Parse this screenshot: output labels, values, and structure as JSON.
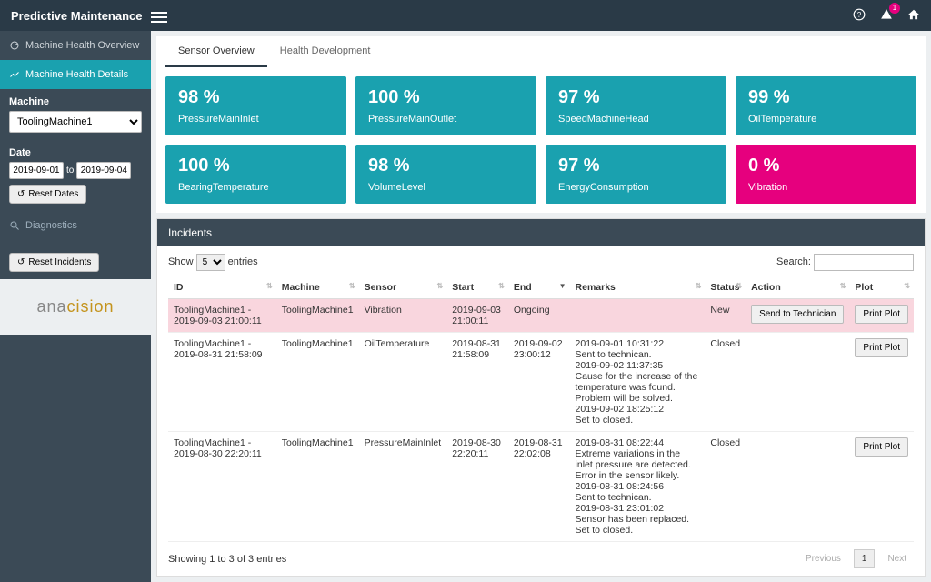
{
  "topbar": {
    "title": "Predictive Maintenance",
    "alert_count": "1"
  },
  "nav": {
    "overview": "Machine Health Overview",
    "details": "Machine Health Details",
    "diagnostics": "Diagnostics"
  },
  "side": {
    "machine_label": "Machine",
    "machine_value": "ToolingMachine1",
    "date_label": "Date",
    "date_from": "2019-09-01",
    "date_to_label": "to",
    "date_to": "2019-09-04",
    "reset_dates": "Reset Dates",
    "reset_incidents": "Reset Incidents"
  },
  "logo": {
    "p1": "ana",
    "p2": "cision"
  },
  "tabs": {
    "sensor": "Sensor Overview",
    "health": "Health Development"
  },
  "cards": [
    {
      "val": "98 %",
      "lbl": "PressureMainInlet",
      "crit": false
    },
    {
      "val": "100 %",
      "lbl": "PressureMainOutlet",
      "crit": false
    },
    {
      "val": "97 %",
      "lbl": "SpeedMachineHead",
      "crit": false
    },
    {
      "val": "99 %",
      "lbl": "OilTemperature",
      "crit": false
    },
    {
      "val": "100 %",
      "lbl": "BearingTemperature",
      "crit": false
    },
    {
      "val": "98 %",
      "lbl": "VolumeLevel",
      "crit": false
    },
    {
      "val": "97 %",
      "lbl": "EnergyConsumption",
      "crit": false
    },
    {
      "val": "0 %",
      "lbl": "Vibration",
      "crit": true
    }
  ],
  "incidents": {
    "title": "Incidents",
    "show": "Show",
    "entries": "entries",
    "page_len": "5",
    "search_label": "Search:",
    "headers": {
      "id": "ID",
      "machine": "Machine",
      "sensor": "Sensor",
      "start": "Start",
      "end": "End",
      "remarks": "Remarks",
      "status": "Status",
      "action": "Action",
      "plot": "Plot"
    },
    "rows": [
      {
        "id": "ToolingMachine1 - 2019-09-03 21:00:11",
        "machine": "ToolingMachine1",
        "sensor": "Vibration",
        "start": "2019-09-03 21:00:11",
        "end": "Ongoing",
        "remarks": [
          ""
        ],
        "status": "New",
        "action": "Send to Technician",
        "plot": "Print Plot",
        "highlight": true
      },
      {
        "id": "ToolingMachine1 - 2019-08-31 21:58:09",
        "machine": "ToolingMachine1",
        "sensor": "OilTemperature",
        "start": "2019-08-31 21:58:09",
        "end": "2019-09-02 23:00:12",
        "remarks": [
          "2019-09-01 10:31:22",
          "Sent to technican.",
          "2019-09-02 11:37:35",
          "Cause for the increase of the temperature was found. Problem will be solved.",
          "2019-09-02 18:25:12",
          "Set to closed."
        ],
        "status": "Closed",
        "action": "",
        "plot": "Print Plot",
        "highlight": false
      },
      {
        "id": "ToolingMachine1 - 2019-08-30 22:20:11",
        "machine": "ToolingMachine1",
        "sensor": "PressureMainInlet",
        "start": "2019-08-30 22:20:11",
        "end": "2019-08-31 22:02:08",
        "remarks": [
          "2019-08-31 08:22:44",
          "Extreme variations in the inlet pressure are detected. Error in the sensor likely.",
          "2019-08-31 08:24:56",
          "Sent to technican.",
          "2019-08-31 23:01:02",
          "Sensor has been replaced. Set to closed."
        ],
        "status": "Closed",
        "action": "",
        "plot": "Print Plot",
        "highlight": false
      }
    ],
    "info": "Showing 1 to 3 of 3 entries",
    "prev": "Previous",
    "next": "Next",
    "page": "1"
  }
}
